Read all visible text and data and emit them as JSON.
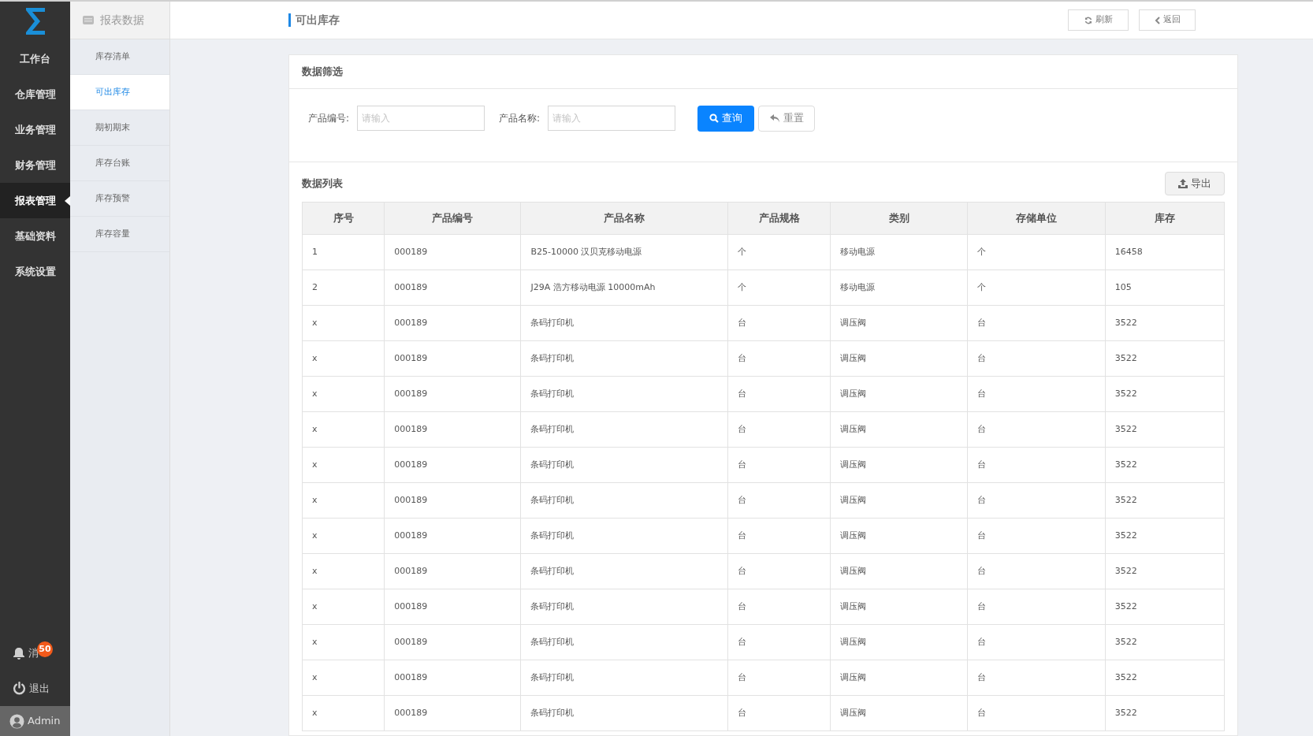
{
  "nav": {
    "items": [
      {
        "label": "工作台",
        "selected": false
      },
      {
        "label": "仓库管理",
        "selected": false
      },
      {
        "label": "业务管理",
        "selected": false
      },
      {
        "label": "财务管理",
        "selected": false
      },
      {
        "label": "报表管理",
        "selected": true
      },
      {
        "label": "基础资料",
        "selected": false
      },
      {
        "label": "系统设置",
        "selected": false
      }
    ],
    "messages": {
      "label": "消",
      "badge": "50"
    },
    "logout": "退出",
    "user": "Admin"
  },
  "subnav": {
    "title": "报表数据",
    "items": [
      {
        "label": "库存清单",
        "selected": false
      },
      {
        "label": "可出库存",
        "selected": true
      },
      {
        "label": "期初期末",
        "selected": false
      },
      {
        "label": "库存台账",
        "selected": false
      },
      {
        "label": "库存预警",
        "selected": false
      },
      {
        "label": "库存容量",
        "selected": false
      }
    ]
  },
  "header": {
    "title": "可出库存",
    "buttons": [
      "刷新",
      "返回"
    ]
  },
  "filter": {
    "title": "数据筛选",
    "fields": [
      {
        "label": "产品编号:",
        "placeholder": "请输入"
      },
      {
        "label": "产品名称:",
        "placeholder": "请输入"
      }
    ],
    "search_button": "查询",
    "reset_button": "重置"
  },
  "table": {
    "title": "数据列表",
    "export_button": "导出",
    "columns": [
      "序号",
      "产品编号",
      "产品名称",
      "产品规格",
      "类别",
      "存储单位",
      "库存"
    ],
    "rows": [
      [
        "1",
        "000189",
        "B25-10000 汉贝克移动电源",
        "个",
        "移动电源",
        "个",
        "16458"
      ],
      [
        "2",
        "000189",
        "J29A 浩方移动电源 10000mAh",
        "个",
        "移动电源",
        "个",
        "105"
      ],
      [
        "x",
        "000189",
        "条码打印机",
        "台",
        "调压阀",
        "台",
        "3522"
      ],
      [
        "x",
        "000189",
        "条码打印机",
        "台",
        "调压阀",
        "台",
        "3522"
      ],
      [
        "x",
        "000189",
        "条码打印机",
        "台",
        "调压阀",
        "台",
        "3522"
      ],
      [
        "x",
        "000189",
        "条码打印机",
        "台",
        "调压阀",
        "台",
        "3522"
      ],
      [
        "x",
        "000189",
        "条码打印机",
        "台",
        "调压阀",
        "台",
        "3522"
      ],
      [
        "x",
        "000189",
        "条码打印机",
        "台",
        "调压阀",
        "台",
        "3522"
      ],
      [
        "x",
        "000189",
        "条码打印机",
        "台",
        "调压阀",
        "台",
        "3522"
      ],
      [
        "x",
        "000189",
        "条码打印机",
        "台",
        "调压阀",
        "台",
        "3522"
      ],
      [
        "x",
        "000189",
        "条码打印机",
        "台",
        "调压阀",
        "台",
        "3522"
      ],
      [
        "x",
        "000189",
        "条码打印机",
        "台",
        "调压阀",
        "台",
        "3522"
      ],
      [
        "x",
        "000189",
        "条码打印机",
        "台",
        "调压阀",
        "台",
        "3522"
      ],
      [
        "x",
        "000189",
        "条码打印机",
        "台",
        "调压阀",
        "台",
        "3522"
      ]
    ]
  }
}
